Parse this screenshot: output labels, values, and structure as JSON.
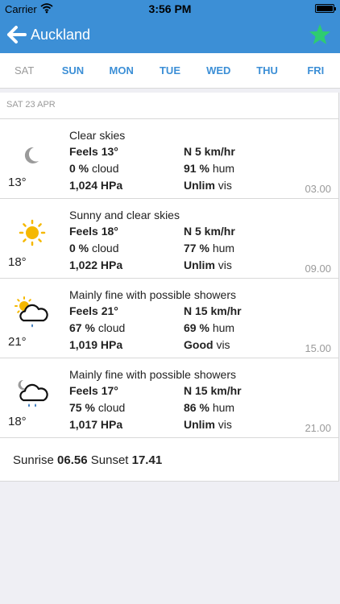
{
  "status_bar": {
    "carrier": "Carrier",
    "time": "3:56 PM"
  },
  "nav": {
    "title": "Auckland"
  },
  "days": [
    "SAT",
    "SUN",
    "MON",
    "TUE",
    "WED",
    "THU",
    "FRI"
  ],
  "date_header": "SAT 23 APR",
  "forecasts": [
    {
      "icon": "moon-icon",
      "temp": "13°",
      "description": "Clear skies",
      "feels_label": "Feels",
      "feels": "13°",
      "wind": "N 5 km/hr",
      "cloud_value": "0 %",
      "cloud_label": "cloud",
      "humidity_value": "91 %",
      "humidity_label": "hum",
      "pressure": "1,024 HPa",
      "visibility_value": "Unlim",
      "visibility_label": "vis",
      "hour": "03.00"
    },
    {
      "icon": "sun-icon",
      "temp": "18°",
      "description": "Sunny and clear skies",
      "feels_label": "Feels",
      "feels": "18°",
      "wind": "N 5 km/hr",
      "cloud_value": "0 %",
      "cloud_label": "cloud",
      "humidity_value": "77 %",
      "humidity_label": "hum",
      "pressure": "1,022 HPa",
      "visibility_value": "Unlim",
      "visibility_label": "vis",
      "hour": "09.00"
    },
    {
      "icon": "sun-cloud-rain-icon",
      "temp": "21°",
      "description": "Mainly fine with possible showers",
      "feels_label": "Feels",
      "feels": "21°",
      "wind": "N 15 km/hr",
      "cloud_value": "67 %",
      "cloud_label": "cloud",
      "humidity_value": "69 %",
      "humidity_label": "hum",
      "pressure": "1,019 HPa",
      "visibility_value": "Good",
      "visibility_label": "vis",
      "hour": "15.00"
    },
    {
      "icon": "moon-cloud-rain-icon",
      "temp": "18°",
      "description": "Mainly fine with possible showers",
      "feels_label": "Feels",
      "feels": "17°",
      "wind": "N 15 km/hr",
      "cloud_value": "75 %",
      "cloud_label": "cloud",
      "humidity_value": "86 %",
      "humidity_label": "hum",
      "pressure": "1,017 HPa",
      "visibility_value": "Unlim",
      "visibility_label": "vis",
      "hour": "21.00"
    }
  ],
  "sun": {
    "sunrise_label": "Sunrise",
    "sunrise": "06.56",
    "sunset_label": "Sunset",
    "sunset": "17.41"
  },
  "colors": {
    "accent": "#3c8fd6",
    "star": "#2ecc71",
    "sun": "#f5b800",
    "rain": "#2a6fb8"
  }
}
